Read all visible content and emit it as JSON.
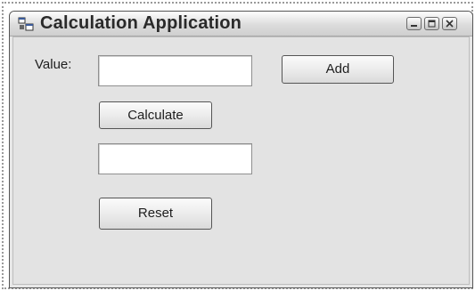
{
  "window": {
    "title": "Calculation Application"
  },
  "controls": {
    "minimize_icon": "minimize-icon",
    "maximize_icon": "maximize-icon",
    "close_icon": "close-icon"
  },
  "form": {
    "value_label": "Value:",
    "value_input": "",
    "result_input": "",
    "add_label": "Add",
    "calculate_label": "Calculate",
    "reset_label": "Reset"
  }
}
